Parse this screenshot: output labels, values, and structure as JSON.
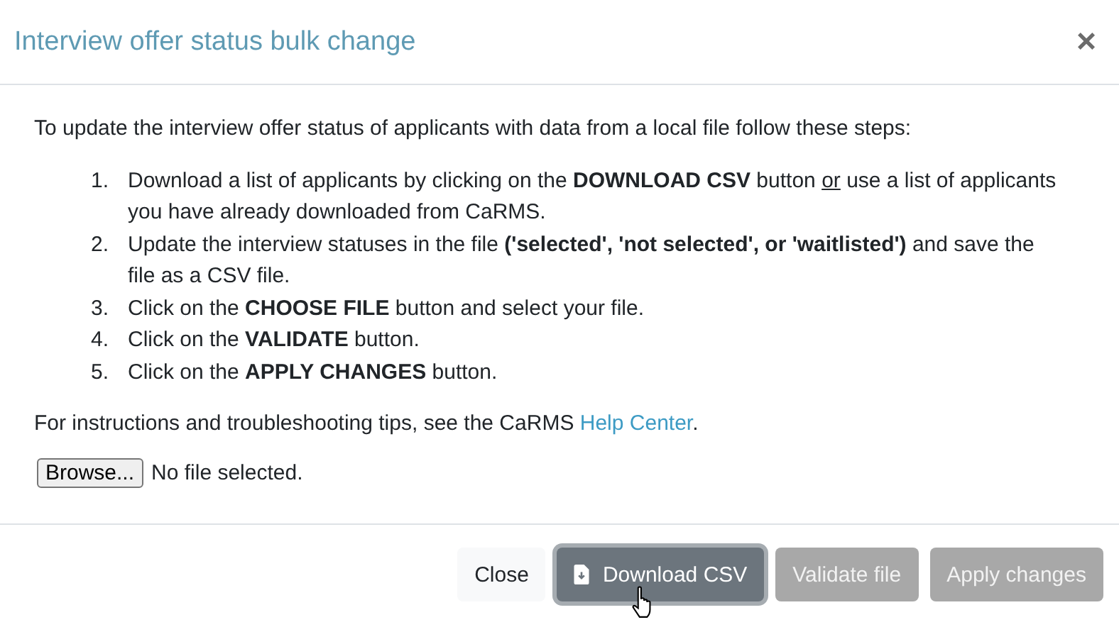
{
  "dialog": {
    "title": "Interview offer status bulk change",
    "close_icon": "×"
  },
  "intro": "To update the interview offer status of applicants with data from a local file follow these steps:",
  "steps": [
    {
      "number": "1.",
      "parts": [
        {
          "text": "Download a list of applicants by clicking on the ",
          "kind": "plain"
        },
        {
          "text": "DOWNLOAD CSV",
          "kind": "bold"
        },
        {
          "text": " button ",
          "kind": "plain"
        },
        {
          "text": "or",
          "kind": "underline"
        },
        {
          "text": " use a list of applicants you have already downloaded from CaRMS.",
          "kind": "plain"
        }
      ]
    },
    {
      "number": "2.",
      "parts": [
        {
          "text": "Update the interview statuses in the file ",
          "kind": "plain"
        },
        {
          "text": "('selected', 'not selected', or 'waitlisted')",
          "kind": "bold"
        },
        {
          "text": " and save the file as a CSV file.",
          "kind": "plain"
        }
      ]
    },
    {
      "number": "3.",
      "parts": [
        {
          "text": "Click on the ",
          "kind": "plain"
        },
        {
          "text": "CHOOSE FILE",
          "kind": "bold"
        },
        {
          "text": " button and select your file.",
          "kind": "plain"
        }
      ]
    },
    {
      "number": "4.",
      "parts": [
        {
          "text": "Click on the ",
          "kind": "plain"
        },
        {
          "text": "VALIDATE",
          "kind": "bold"
        },
        {
          "text": " button.",
          "kind": "plain"
        }
      ]
    },
    {
      "number": "5.",
      "parts": [
        {
          "text": "Click on the ",
          "kind": "plain"
        },
        {
          "text": "APPLY CHANGES",
          "kind": "bold"
        },
        {
          "text": " button.",
          "kind": "plain"
        }
      ]
    }
  ],
  "help": {
    "text": "For instructions and troubleshooting tips, see the CaRMS ",
    "link": "Help Center",
    "after": "."
  },
  "file_input": {
    "button": "Browse...",
    "status": "No file selected."
  },
  "buttons": [
    {
      "label": "Close",
      "kind": "light",
      "disabled": false,
      "focused": false
    },
    {
      "label": "Download CSV",
      "kind": "download",
      "disabled": false,
      "focused": true
    },
    {
      "label": "Validate file",
      "kind": "secondary",
      "disabled": true,
      "focused": false
    },
    {
      "label": "Apply changes",
      "kind": "secondary",
      "disabled": true,
      "focused": false
    }
  ]
}
